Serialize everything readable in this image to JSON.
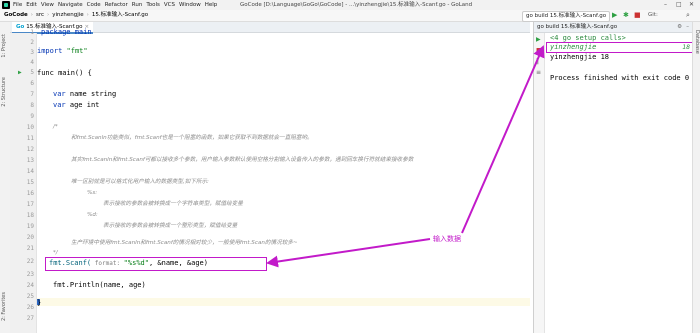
{
  "window": {
    "title": "GoCode [D:\\Language\\GoGo\\GoCode] - ...\\yinzhengjie\\15.标准输入-Scanf.go - GoLand",
    "menu": [
      "File",
      "Edit",
      "View",
      "Navigate",
      "Code",
      "Refactor",
      "Run",
      "Tools",
      "VCS",
      "Window",
      "Help"
    ]
  },
  "breadcrumbs": [
    "GoCode",
    "src",
    "yinzhengjie",
    "15.标准输入-Scanf.go"
  ],
  "toolbar": {
    "run_config": "go build 15.标准输入-Scanf.go",
    "icons": [
      "run-icon",
      "debug-icon",
      "stop-icon",
      "git-icon",
      "search-icon"
    ]
  },
  "editor_tab": {
    "label": "15.标准输入-Scanf.go"
  },
  "left_tool_windows": [
    "1: Project",
    "2: Structure",
    "2: Favorites"
  ],
  "right_tool_windows": [
    "Database"
  ],
  "line_numbers": [
    "1",
    "2",
    "3",
    "4",
    "5",
    "6",
    "7",
    "8",
    "9",
    "10",
    "11",
    "12",
    "13",
    "14",
    "15",
    "16",
    "17",
    "18",
    "19",
    "20",
    "21",
    "22",
    "23",
    "24",
    "25",
    "26",
    "27"
  ],
  "code": {
    "package": "package main",
    "import_kw": "import",
    "import_path": "\"fmt\"",
    "func_sig": "func main() {",
    "var1_kw": "var",
    "var1": " name string",
    "var2_kw": "var",
    "var2": " age int",
    "cmt_open": "/*",
    "cmt1": "和fmt.Scanln功能类似，fmt.Scanf也是一个阻塞的函数，如果它获取不到数据就会一直阻塞哟。",
    "cmt2": "其实fmt.Scanln和fmt.Scanf可都以接收多个参数，用户输入参数默认使用空格分割输入设备传入的参数，遇到回车换行符就结束接收参数",
    "cmt3": "唯一区别就是可以格式化用户输入的数据类型,如下所示:",
    "cmt4": "%s:",
    "cmt5": "表示接收的参数会被转换成一个字符串类型，赋值给变量",
    "cmt6": "%d:",
    "cmt7": "表示接收的参数会被转换成一个整形类型，赋值给变量",
    "cmt8": "生产环境中使用fmt.Scanln和fmt.Scanf的情况相对较少，一般使用fmt.Scan的情况较多~",
    "cmt_close": "*/",
    "scanf_call": "fmt.Scanf(",
    "scanf_hint": " format: ",
    "scanf_fmt": "\"%s%d\"",
    "scanf_args": ", &name, &age)",
    "println": "fmt.Println(name, age)",
    "close_brace": "}"
  },
  "run_panel": {
    "title": "go build 15.标准输入-Scanf.go",
    "lines": [
      "<4 go setup calls>",
      "yinzhengjie",
      "yinzhengjie 18",
      "",
      "Process finished with exit code 0"
    ],
    "input_number": "18"
  },
  "annotation": {
    "label": "输入数据",
    "color": "#c21ac9"
  }
}
